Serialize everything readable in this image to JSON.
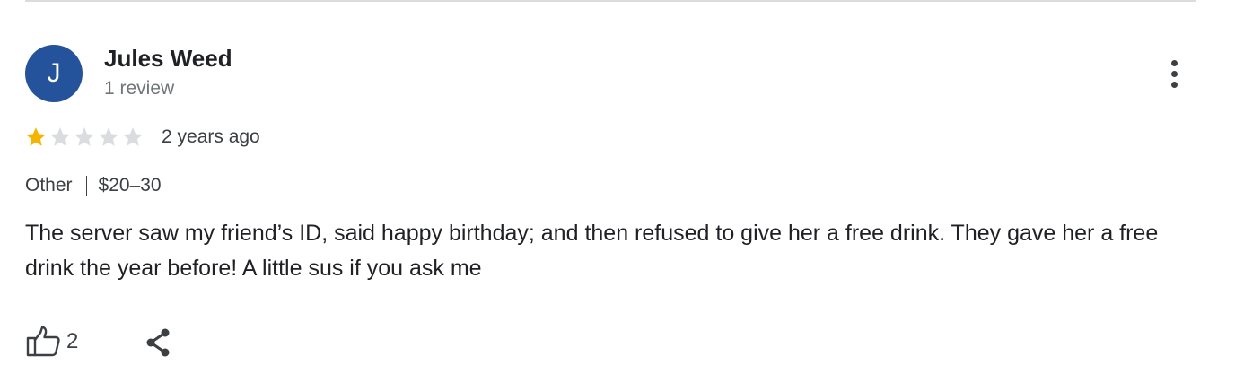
{
  "review": {
    "author": {
      "initial": "J",
      "name": "Jules Weed",
      "review_count": "1 review",
      "avatar_color": "#24539b"
    },
    "rating": {
      "value": 1,
      "max": 5,
      "filled_color": "#f4b400",
      "empty_color": "#dadce0"
    },
    "time_ago": "2 years ago",
    "category": "Other",
    "price_range": "$20–30",
    "text": "The server saw my friend’s ID, said happy birthday; and then refused to give her a free drink. They gave her a free drink the year before! A little sus if you ask me",
    "actions": {
      "like_icon": "thumbs-up-icon",
      "like_count": "2",
      "share_icon": "share-icon",
      "more_icon": "more-vert-icon"
    }
  }
}
